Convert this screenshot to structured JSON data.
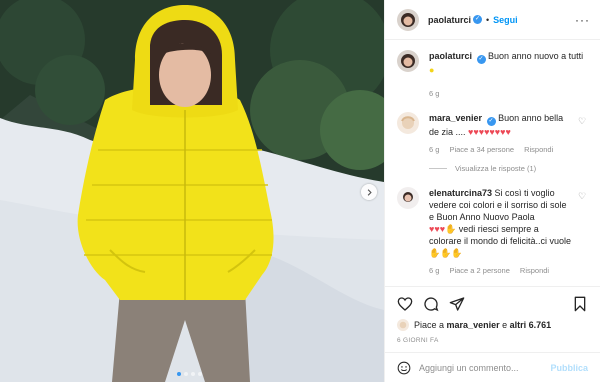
{
  "post_header": {
    "username": "paolaturci",
    "verified": true,
    "separator": "•",
    "follow_label": "Segui",
    "more_icon": "more-options-icon"
  },
  "caption": {
    "username": "paolaturci",
    "text": "Buon anno nuovo a tutti",
    "emoji": "lemon",
    "time": "6 g"
  },
  "comments": [
    {
      "username": "mara_venier",
      "verified": true,
      "text": "Buon anno bella de zia ....",
      "hearts": 8,
      "time": "6 g",
      "likes": "Piace a 34 persone",
      "reply_label": "Rispondi",
      "view_replies": "Visualizza le risposte (1)"
    },
    {
      "username": "elenaturcina73",
      "verified": false,
      "text": "Si così ti voglio vedere coi colori e il sorriso di sole e Buon Anno Nuovo Paola",
      "text2": "vedi riesci sempre a colorare il mondo di felicità..ci vuole",
      "time": "6 g",
      "likes": "Piace a 2 persone",
      "reply_label": "Rispondi"
    }
  ],
  "liked_by": {
    "prefix": "Piace a",
    "user": "mara_venier",
    "middle": "e",
    "rest": "altri 6.761"
  },
  "date": "6 GIORNI FA",
  "add_comment": {
    "placeholder": "Aggiungi un commento...",
    "publish_label": "Pubblica"
  },
  "carousel": {
    "total": 4,
    "active_index": 0
  },
  "colors": {
    "accent": "#0095f6",
    "heart": "#ed4956",
    "jacket": "#f2e21a",
    "snow": "#e8ecf1"
  }
}
